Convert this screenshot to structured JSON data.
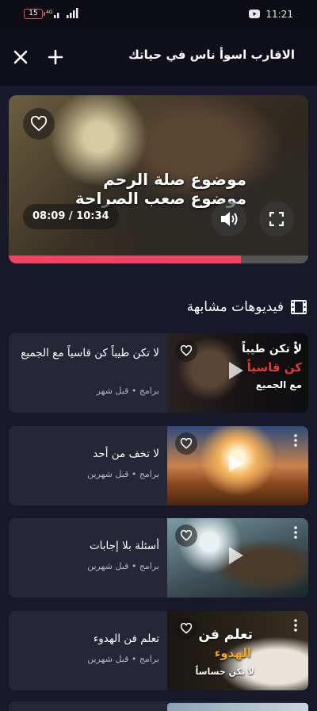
{
  "status": {
    "time": "11:21",
    "battery": "15"
  },
  "header": {
    "title": "الاقارب اسوأ ناس في حياتك"
  },
  "player": {
    "caption": "موضوع صلة الرحم موضوع صعب الصراحة",
    "current_time": "08:09",
    "duration": "10:34",
    "time_separator": " / ",
    "progress_fraction": 0.775
  },
  "related": {
    "heading": "فيديوهات مشابهة",
    "items": [
      {
        "title": "لا تكن طيباً كن قاسياً مع الجميع",
        "category": "برامج",
        "age": "قبل شهر",
        "thumb_lines": [
          "لا تكن طيباً",
          "كن قاسياً",
          "مع الجميع"
        ]
      },
      {
        "title": "لا تخف من أحد",
        "category": "برامج",
        "age": "قبل شهرين"
      },
      {
        "title": "أسئلة بلا إجابات",
        "category": "برامج",
        "age": "قبل شهرين"
      },
      {
        "title": "تعلم فن الهدوء",
        "category": "برامج",
        "age": "قبل شهرين",
        "thumb_lines": [
          "تعلم فن",
          "الهدوء",
          "لا تكن حساساً"
        ]
      }
    ]
  },
  "colors": {
    "accent": "#f14263",
    "card": "#252739",
    "background": "#17192b"
  }
}
